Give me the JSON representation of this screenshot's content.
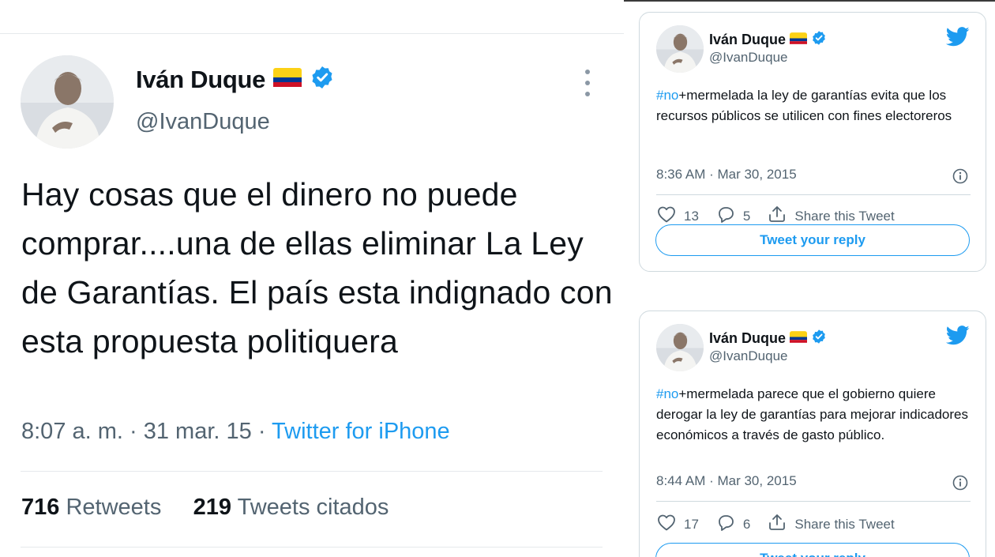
{
  "main_tweet": {
    "author_name": "Iván Duque",
    "author_handle": "@IvanDuque",
    "text": "Hay cosas que el dinero no puede comprar....una de ellas eliminar La Ley de Garantías. El país esta indignado con esta propuesta politiquera",
    "timestamp": "8:07 a. m. · 31 mar. 15 · ",
    "source": "Twitter for iPhone",
    "retweets_count": "716",
    "retweets_label": "Retweets",
    "quotes_count": "219",
    "quotes_label": "Tweets citados",
    "flag_icon": "colombia-flag-icon",
    "verified_icon": "verified-badge-icon",
    "menu_icon": "more-options-icon"
  },
  "embed_tweets": [
    {
      "author_name": "Iván Duque",
      "author_handle": "@IvanDuque",
      "hashtag": "#no",
      "text": "+mermelada la ley de garantías evita que los recursos públicos se utilicen con fines electoreros",
      "timestamp": "8:36 AM · Mar 30, 2015",
      "likes": "13",
      "replies": "5",
      "share_label": "Share this Tweet",
      "reply_button": "Tweet your reply"
    },
    {
      "author_name": "Iván Duque",
      "author_handle": "@IvanDuque",
      "hashtag": "#no",
      "text": "+mermelada parece que el gobierno quiere derogar la ley de garantías para mejorar indicadores económicos a través de gasto público.",
      "timestamp": "8:44 AM · Mar 30, 2015",
      "likes": "17",
      "replies": "6",
      "share_label": "Share this Tweet",
      "reply_button": "Tweet your reply"
    }
  ],
  "colors": {
    "twitter_blue": "#1d9bf0",
    "text_secondary": "#536471",
    "flag_yellow": "#fcd116",
    "flag_blue": "#003893",
    "flag_red": "#ce1126"
  }
}
